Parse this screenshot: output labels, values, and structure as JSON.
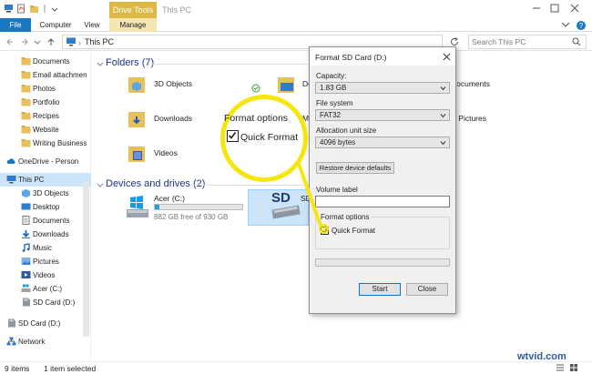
{
  "window": {
    "title": "This PC",
    "context_tab": "Drive Tools"
  },
  "ribbon": {
    "tabs": [
      "File",
      "Computer",
      "View",
      "Manage"
    ]
  },
  "address": {
    "path": "This PC",
    "search_placeholder": "Search This PC"
  },
  "nav": {
    "items": [
      {
        "label": "Documents",
        "icon": "folder-icon"
      },
      {
        "label": "Email attachmen",
        "icon": "folder-icon"
      },
      {
        "label": "Photos",
        "icon": "folder-icon"
      },
      {
        "label": "Portfolio",
        "icon": "folder-icon"
      },
      {
        "label": "Recipes",
        "icon": "folder-icon"
      },
      {
        "label": "Website",
        "icon": "folder-icon"
      },
      {
        "label": "Writing Business",
        "icon": "folder-icon"
      },
      {
        "label": "OneDrive - Person",
        "icon": "cloud-icon"
      },
      {
        "label": "This PC",
        "icon": "pc-icon",
        "selected": true
      },
      {
        "label": "3D Objects",
        "icon": "cube-icon"
      },
      {
        "label": "Desktop",
        "icon": "desktop-icon"
      },
      {
        "label": "Documents",
        "icon": "documents-icon"
      },
      {
        "label": "Downloads",
        "icon": "download-icon"
      },
      {
        "label": "Music",
        "icon": "music-icon"
      },
      {
        "label": "Pictures",
        "icon": "pictures-icon"
      },
      {
        "label": "Videos",
        "icon": "videos-icon"
      },
      {
        "label": "Acer (C:)",
        "icon": "drive-icon"
      },
      {
        "label": "SD Card (D:)",
        "icon": "sdcard-icon"
      },
      {
        "label": "SD Card (D:)",
        "icon": "sdcard-icon"
      },
      {
        "label": "Network",
        "icon": "network-icon"
      }
    ]
  },
  "content": {
    "folders_title": "Folders (7)",
    "folders": [
      "3D Objects",
      "De",
      "Documents",
      "Downloads",
      "M",
      "Pictures",
      "Videos"
    ],
    "devices_title": "Devices and drives (2)",
    "drive_c_label": "Acer (C:)",
    "drive_c_free": "882 GB free of 930 GB",
    "drive_c_used_fraction": 0.05,
    "sd_icon_text": "SD",
    "sd_label": "SD"
  },
  "status": {
    "items": "9 items",
    "selected": "1 item selected"
  },
  "dialog": {
    "title": "Format SD Card (D:)",
    "capacity_label": "Capacity:",
    "capacity_value": "1.83 GB",
    "fs_label": "File system",
    "fs_value": "FAT32",
    "alloc_label": "Allocation unit size",
    "alloc_value": "4096 bytes",
    "restore_button": "Restore device defaults",
    "volume_label": "Volume label",
    "volume_value": "",
    "format_options_label": "Format options",
    "quick_format_label": "Quick Format",
    "quick_format_checked": true,
    "start_button": "Start",
    "close_button": "Close"
  },
  "magnifier": {
    "format_options": "Format options",
    "quick_format": "Quick Format"
  },
  "watermark": "wtvid.com",
  "colors": {
    "file_tab": "#1a78c2",
    "drive_tools": "#dcb844",
    "callout": "#f5e60f",
    "section_title": "#1e3287"
  }
}
